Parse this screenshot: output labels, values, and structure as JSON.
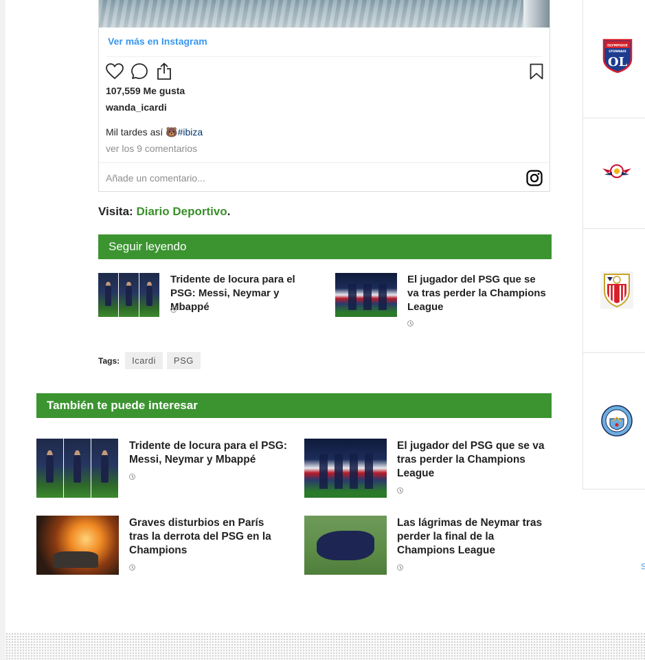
{
  "instagram": {
    "see_more": "Ver más en Instagram",
    "likes": "107,559 Me gusta",
    "username": "wanda_icardi",
    "caption_text": "Mil tardes así ",
    "caption_emoji": "🐻",
    "caption_hashtag": "#ibiza",
    "comments_link": "ver los 9 comentarios",
    "add_comment_placeholder": "Añade un comentario..."
  },
  "visita": {
    "label": "Visita: ",
    "link": "Diario Deportivo",
    "suffix": "."
  },
  "seguir_leyendo": {
    "heading": "Seguir leyendo",
    "items": [
      {
        "title": "Tridente de locura para el PSG: Messi, Neymar y Mbappé",
        "thumb": "trio"
      },
      {
        "title": "El jugador del PSG que se va tras perder la Champions League",
        "thumb": "players"
      }
    ]
  },
  "tags": {
    "label": "Tags:",
    "items": [
      "Icardi",
      "PSG"
    ]
  },
  "tambien": {
    "heading": "También te puede interesar",
    "items": [
      {
        "title": "Tridente de locura para el PSG: Messi, Neymar y Mbappé",
        "thumb": "trio"
      },
      {
        "title": "El jugador del PSG que se va tras perder la Champions League",
        "thumb": "players"
      },
      {
        "title": "Graves disturbios en París tras la derrota del PSG en la Champions",
        "thumb": "fire"
      },
      {
        "title": "Las lágrimas de Neymar tras perder la final de la Champions League",
        "thumb": "neymar"
      }
    ]
  },
  "sidebar": {
    "crests": [
      "olympique-lyonnais-crest-icon",
      "rb-leipzig-crest-icon",
      "sevilla-crest-icon",
      "manchester-city-crest-icon"
    ],
    "cut_text": "S"
  },
  "colors": {
    "green": "#3b9430",
    "link_green": "#3a8f2b",
    "instagram_blue": "#3897f0"
  }
}
